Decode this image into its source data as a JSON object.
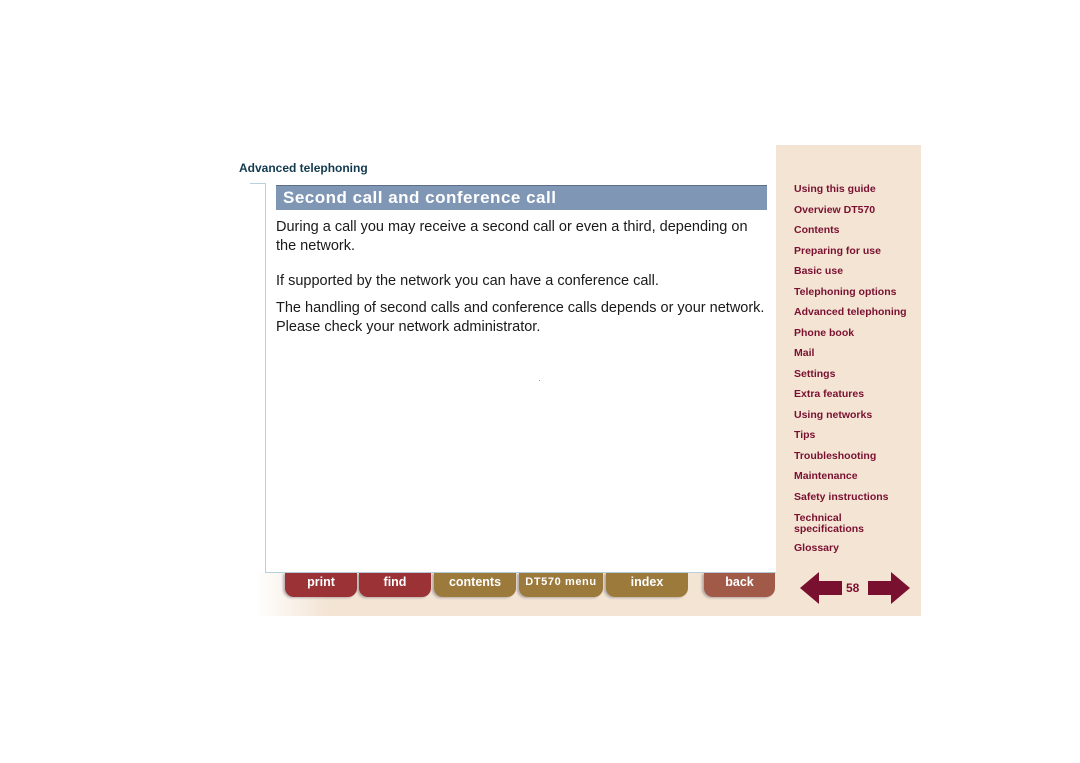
{
  "header": {
    "section": "Advanced telephoning"
  },
  "main": {
    "title": "Second call and conference call",
    "paragraphs": [
      "During a call you may receive a second call or even a third, depending on the network.",
      "If supported by the network you can have a conference call.",
      "The handling of second calls and conference calls depends or your network. Please check your network administrator."
    ]
  },
  "sidebar": {
    "items": [
      {
        "label": "Using this guide"
      },
      {
        "label": "Overview DT570"
      },
      {
        "label": "Contents"
      },
      {
        "label": "Preparing for use"
      },
      {
        "label": "Basic use"
      },
      {
        "label": "Telephoning options"
      },
      {
        "label": "Advanced telephoning"
      },
      {
        "label": "Phone book"
      },
      {
        "label": "Mail"
      },
      {
        "label": "Settings"
      },
      {
        "label": "Extra features"
      },
      {
        "label": "Using networks"
      },
      {
        "label": "Tips"
      },
      {
        "label": "Troubleshooting"
      },
      {
        "label": "Maintenance"
      },
      {
        "label": "Safety instructions"
      },
      {
        "label": "Technical specifications"
      },
      {
        "label": "Glossary"
      }
    ]
  },
  "footer": {
    "buttons": {
      "print": "print",
      "find": "find",
      "contents": "contents",
      "menu": "DT570 menu",
      "index": "index",
      "back": "back"
    },
    "page_number": "58",
    "prev_icon": "arrow-left-icon",
    "next_icon": "arrow-right-icon"
  },
  "colors": {
    "accent": "#7a1030",
    "title_bar": "#7f96b5",
    "sidebar_bg": "#f3e4d4"
  }
}
